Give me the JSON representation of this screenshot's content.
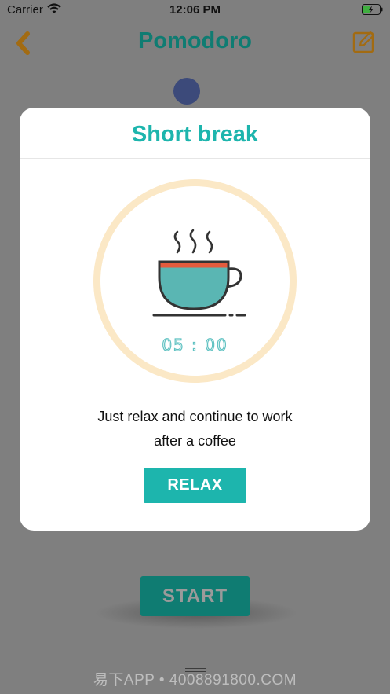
{
  "status_bar": {
    "carrier": "Carrier",
    "time": "12:06 PM",
    "wifi_icon": "wifi-icon",
    "battery_icon": "battery-charging-icon"
  },
  "nav": {
    "title": "Pomodoro",
    "back_icon": "chevron-left-icon",
    "edit_icon": "edit-icon"
  },
  "main": {
    "start_label": "START"
  },
  "modal": {
    "title": "Short break",
    "illustration_icon": "coffee-cup-icon",
    "timer": "05 : 00",
    "message_line1": "Just relax and continue to work",
    "message_line2": "after a coffee",
    "relax_label": "RELAX"
  },
  "watermark": "易下APP • 4008891800.COM",
  "colors": {
    "brand": "#1db5ad",
    "brand_dark_dimmed": "#0f7c72",
    "accent_orange": "#c98a2a",
    "ring": "#fbe8c6",
    "overlay": "#7f7f7f"
  }
}
